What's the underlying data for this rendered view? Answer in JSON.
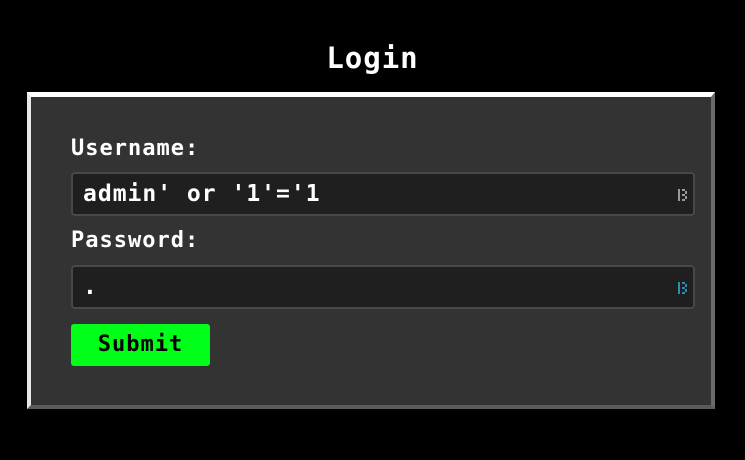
{
  "page": {
    "title": "Login"
  },
  "form": {
    "username_label": "Username:",
    "username_value": "admin' or '1'='1",
    "password_label": "Password:",
    "password_value": ".",
    "submit_label": "Submit",
    "username_icon": "autofill-key-icon",
    "password_icon": "autofill-key-icon"
  },
  "colors": {
    "background": "#000000",
    "panel": "#333333",
    "input_background": "#1f1f1f",
    "submit_background": "#00ff19",
    "text": "#ffffff"
  }
}
